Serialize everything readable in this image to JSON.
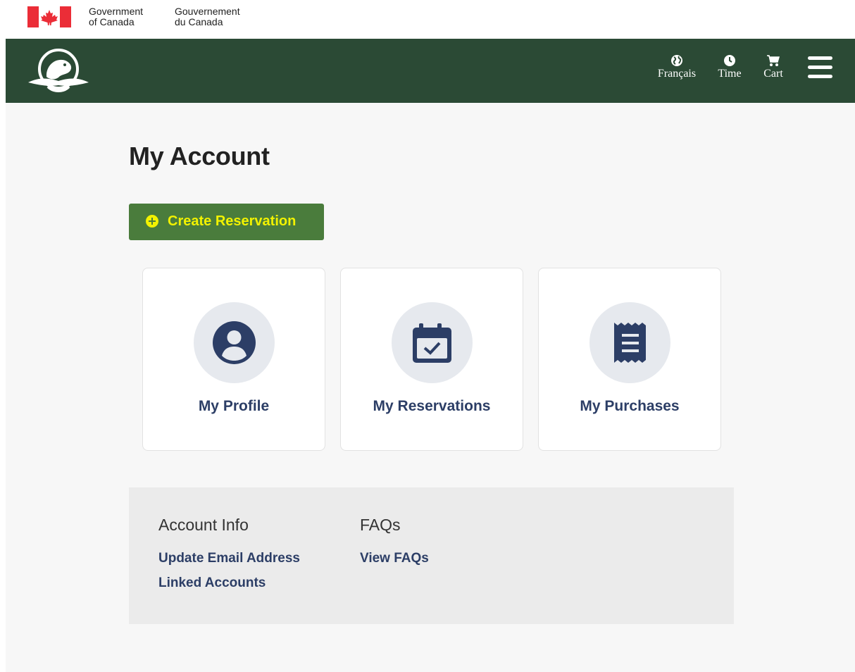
{
  "gov_bar": {
    "english_line1": "Government",
    "english_line2": "of Canada",
    "french_line1": "Gouvernement",
    "french_line2": "du Canada"
  },
  "header": {
    "language_label": "Français",
    "time_label": "Time",
    "cart_label": "Cart",
    "logo_icon": "beaver-logo-icon",
    "menu_icon": "hamburger-menu-icon",
    "background_color": "#2b4a35"
  },
  "main": {
    "page_title": "My Account",
    "create_button_label": "Create Reservation",
    "create_button_color": "#4a7c3c",
    "create_button_text_color": "#f2f200",
    "cards": [
      {
        "label": "My Profile",
        "icon": "user-circle-icon"
      },
      {
        "label": "My Reservations",
        "icon": "calendar-check-icon"
      },
      {
        "label": "My Purchases",
        "icon": "receipt-icon"
      }
    ]
  },
  "info": {
    "account_heading": "Account Info",
    "account_links": [
      "Update Email Address",
      "Linked Accounts"
    ],
    "faq_heading": "FAQs",
    "faq_links": [
      "View FAQs"
    ]
  }
}
